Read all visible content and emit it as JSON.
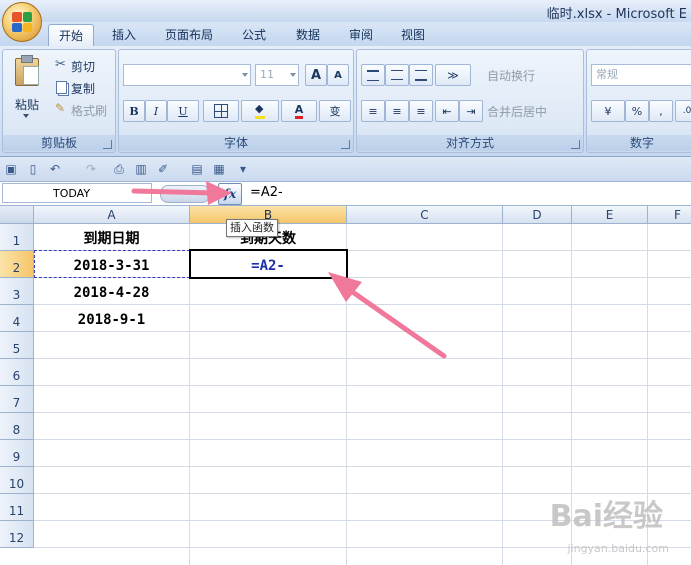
{
  "window": {
    "title": "临时.xlsx - Microsoft E"
  },
  "tabs": [
    {
      "label": "开始",
      "active": true
    },
    {
      "label": "插入"
    },
    {
      "label": "页面布局"
    },
    {
      "label": "公式"
    },
    {
      "label": "数据"
    },
    {
      "label": "审阅"
    },
    {
      "label": "视图"
    }
  ],
  "ribbon": {
    "clipboard": {
      "label": "剪贴板",
      "paste": "粘贴",
      "cut": "剪切",
      "copy": "复制",
      "format_painter": "格式刷"
    },
    "font": {
      "label": "字体",
      "font_size": "11",
      "bold": "B",
      "italic": "I",
      "underline": "U",
      "grow": "A",
      "shrink": "A",
      "font_color": "A",
      "phonetic": "变"
    },
    "alignment": {
      "label": "对齐方式",
      "wrap_text": "自动换行",
      "merge_center": "合并后居中"
    },
    "number": {
      "label": "数字",
      "format": "常规",
      "percent": "%",
      "comma": ","
    }
  },
  "formula_bar": {
    "name_box": "TODAY",
    "fx": "fx",
    "formula": "=A2-",
    "tooltip": "插入函数"
  },
  "sheet": {
    "columns": [
      "A",
      "B",
      "C",
      "D",
      "E",
      "F"
    ],
    "rows": [
      "1",
      "2",
      "3",
      "4",
      "5",
      "6",
      "7",
      "8",
      "9",
      "10",
      "11",
      "12"
    ],
    "cells": {
      "A1": "到期日期",
      "B1": "到期天数",
      "A2": "2018-3-31",
      "B2": "=A2-",
      "A3": "2018-4-28",
      "A4": "2018-9-1"
    },
    "active_cell": "B2",
    "selected_column": "B",
    "selected_row": "2"
  },
  "watermark": {
    "brand": "Bai经验",
    "url": "jingyan.baidu.com"
  },
  "colors": {
    "arrow": "#f0789a",
    "accent": "#1c3f7a",
    "selection": "#f5c66a"
  }
}
